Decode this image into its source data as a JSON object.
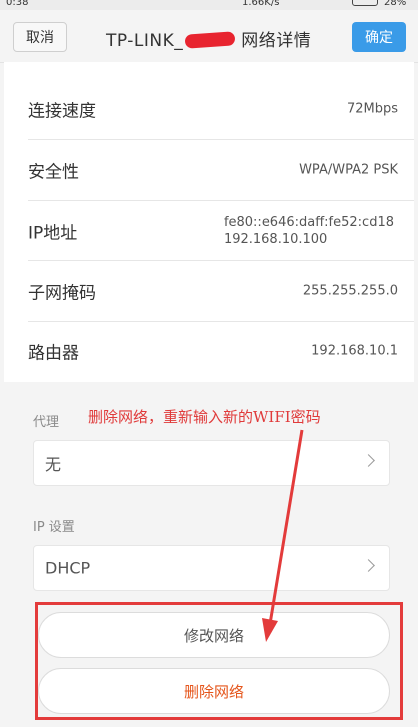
{
  "status_bar": {
    "time": "0:38",
    "speed": "1.66K/s",
    "battery": "28%"
  },
  "header": {
    "cancel_label": "取消",
    "title_prefix": "TP-LINK_",
    "title_suffix": "网络详情",
    "confirm_label": "确定"
  },
  "details": [
    {
      "label": "连接速度",
      "value": "72Mbps"
    },
    {
      "label": "安全性",
      "value": "WPA/WPA2 PSK"
    },
    {
      "label": "IP地址",
      "value_line1": "fe80::e646:daff:fe52:cd18",
      "value_line2": "192.168.10.100"
    },
    {
      "label": "子网掩码",
      "value": "255.255.255.0"
    },
    {
      "label": "路由器",
      "value": "192.168.10.1"
    }
  ],
  "proxy": {
    "label": "代理",
    "value": "无"
  },
  "ip_settings": {
    "label": "IP 设置",
    "value": "DHCP"
  },
  "actions": {
    "modify_label": "修改网络",
    "delete_label": "删除网络"
  },
  "annotation": {
    "text": "删除网络，重新输入新的WIFI密码",
    "color": "#e03a3a"
  },
  "colors": {
    "accent": "#3a9be8",
    "delete_text": "#e5551b",
    "highlight": "#e33b3b"
  }
}
